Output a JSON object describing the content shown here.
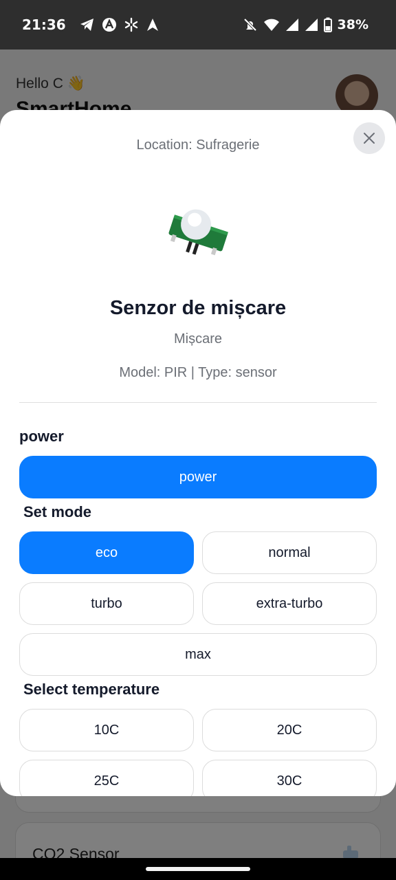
{
  "status_bar": {
    "time": "21:36",
    "left_icons": [
      "telegram-icon",
      "app-a-icon",
      "pinwheel-icon",
      "navigation-icon"
    ],
    "right_icons": [
      "mute-icon",
      "wifi-icon",
      "signal-icon",
      "signal-icon",
      "battery-icon"
    ],
    "battery": "38%"
  },
  "background_app": {
    "greeting": "Hello C 👋",
    "title": "SmartHome",
    "card_title": "CO2 Sensor"
  },
  "modal": {
    "location": "Location: Sufragerie",
    "device_name": "Senzor de mișcare",
    "category": "Mișcare",
    "meta": "Model: PIR | Type: sensor",
    "power_section": {
      "label": "power",
      "button": "power",
      "active": true
    },
    "mode_section": {
      "label": "Set mode",
      "options": [
        "eco",
        "normal",
        "turbo",
        "extra-turbo",
        "max"
      ],
      "selected": "eco"
    },
    "temperature_section": {
      "label": "Select temperature",
      "options": [
        "10C",
        "20C",
        "25C",
        "30C"
      ],
      "selected": null
    }
  },
  "colors": {
    "accent": "#0a7cff",
    "status_bar": "#2e2e2e",
    "title_text": "#141a2b",
    "muted_text": "#6b6f76"
  }
}
